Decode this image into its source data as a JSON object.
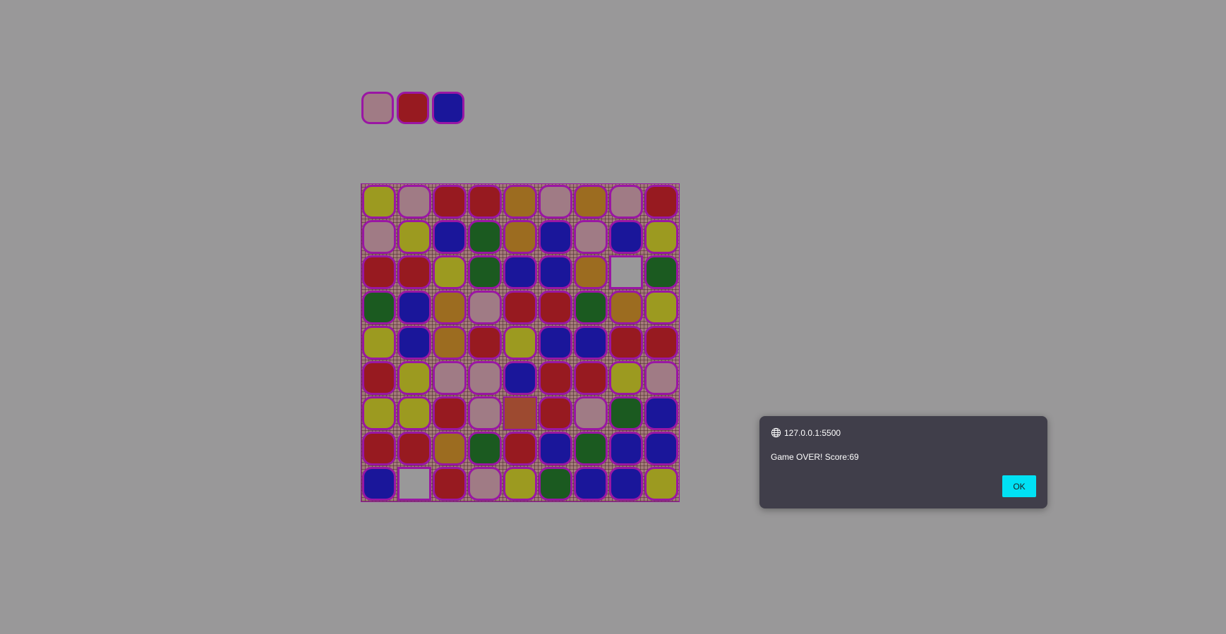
{
  "colors": {
    "pink": "#a07b85",
    "red": "#971a20",
    "blue": "#1a169a",
    "yellow": "#9c9a20",
    "orange": "#9c6c20",
    "green": "#1b5a20",
    "empty": "#999899",
    "selected": "#9d4a30",
    "border": "#9a16a4"
  },
  "next_pieces": [
    "pink",
    "red",
    "blue"
  ],
  "board": [
    [
      "yellow",
      "pink",
      "red",
      "red",
      "orange",
      "pink",
      "orange",
      "pink",
      "red"
    ],
    [
      "pink",
      "yellow",
      "blue",
      "green",
      "orange",
      "blue",
      "pink",
      "blue",
      "yellow"
    ],
    [
      "red",
      "red",
      "yellow",
      "green",
      "blue",
      "blue",
      "orange",
      "empty",
      "green"
    ],
    [
      "green",
      "blue",
      "orange",
      "pink",
      "red",
      "red",
      "green",
      "orange",
      "yellow"
    ],
    [
      "yellow",
      "blue",
      "orange",
      "red",
      "yellow",
      "blue",
      "blue",
      "red",
      "red"
    ],
    [
      "red",
      "yellow",
      "pink",
      "pink",
      "blue",
      "red",
      "red",
      "yellow",
      "pink"
    ],
    [
      "yellow",
      "yellow",
      "red",
      "pink",
      "selected",
      "red",
      "pink",
      "green",
      "blue"
    ],
    [
      "red",
      "red",
      "orange",
      "green",
      "red",
      "blue",
      "green",
      "blue",
      "blue"
    ],
    [
      "blue",
      "empty",
      "red",
      "pink",
      "yellow",
      "green",
      "blue",
      "blue",
      "yellow"
    ]
  ],
  "dialog": {
    "origin": "127.0.0.1:5500",
    "message": "Game OVER! Score:69",
    "ok_label": "OK"
  }
}
